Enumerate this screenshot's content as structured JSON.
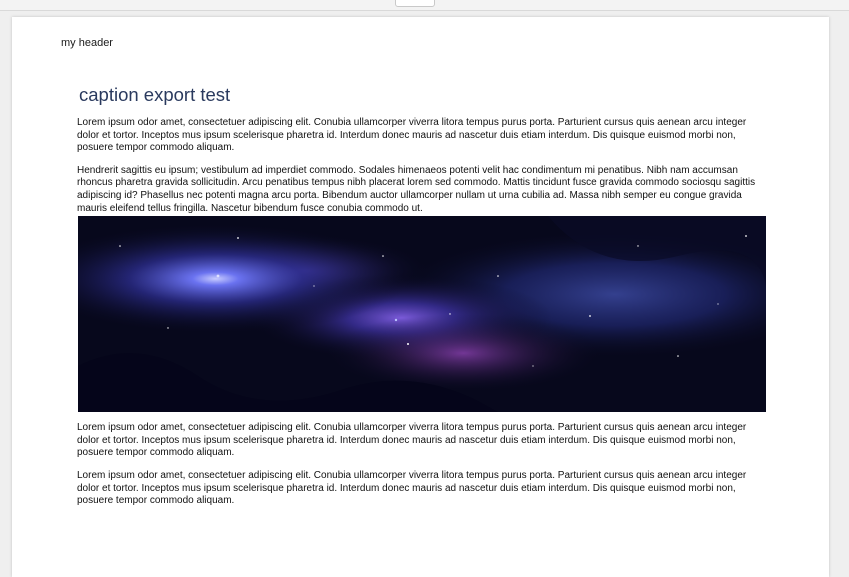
{
  "document": {
    "header": "my header",
    "title": "caption export test",
    "paragraphs_before": [
      "Lorem ipsum odor amet, consectetuer adipiscing elit. Conubia ullamcorper viverra litora tempus purus porta. Parturient cursus quis aenean arcu integer dolor et tortor. Inceptos mus ipsum scelerisque pharetra id. Interdum donec mauris ad nascetur duis etiam interdum. Dis quisque euismod morbi non, posuere tempor commodo aliquam.",
      "Hendrerit sagittis eu ipsum; vestibulum ad imperdiet commodo. Sodales himenaeos potenti velit hac condimentum mi penatibus. Nibh nam accumsan rhoncus pharetra gravida sollicitudin. Arcu penatibus tempus nibh placerat lorem sed commodo. Mattis tincidunt fusce gravida commodo sociosqu sagittis adipiscing id? Phasellus nec potenti magna arcu porta. Bibendum auctor ullamcorper nullam ut urna cubilia ad. Massa nibh semper eu congue gravida mauris eleifend tellus fringilla. Nascetur bibendum fusce conubia commodo ut."
    ],
    "paragraphs_after": [
      "Lorem ipsum odor amet, consectetuer adipiscing elit. Conubia ullamcorper viverra litora tempus purus porta. Parturient cursus quis aenean arcu integer dolor et tortor. Inceptos mus ipsum scelerisque pharetra id. Interdum donec mauris ad nascetur duis etiam interdum. Dis quisque euismod morbi non, posuere tempor commodo aliquam.",
      "Lorem ipsum odor amet, consectetuer adipiscing elit. Conubia ullamcorper viverra litora tempus purus porta. Parturient cursus quis aenean arcu integer dolor et tortor. Inceptos mus ipsum scelerisque pharetra id. Interdum donec mauris ad nascetur duis etiam interdum. Dis quisque euismod morbi non, posuere tempor commodo aliquam."
    ]
  },
  "colors": {
    "title": "#2a3a5e",
    "nebula_dark": "#07081c",
    "nebula_glow": "#4a58e8"
  }
}
